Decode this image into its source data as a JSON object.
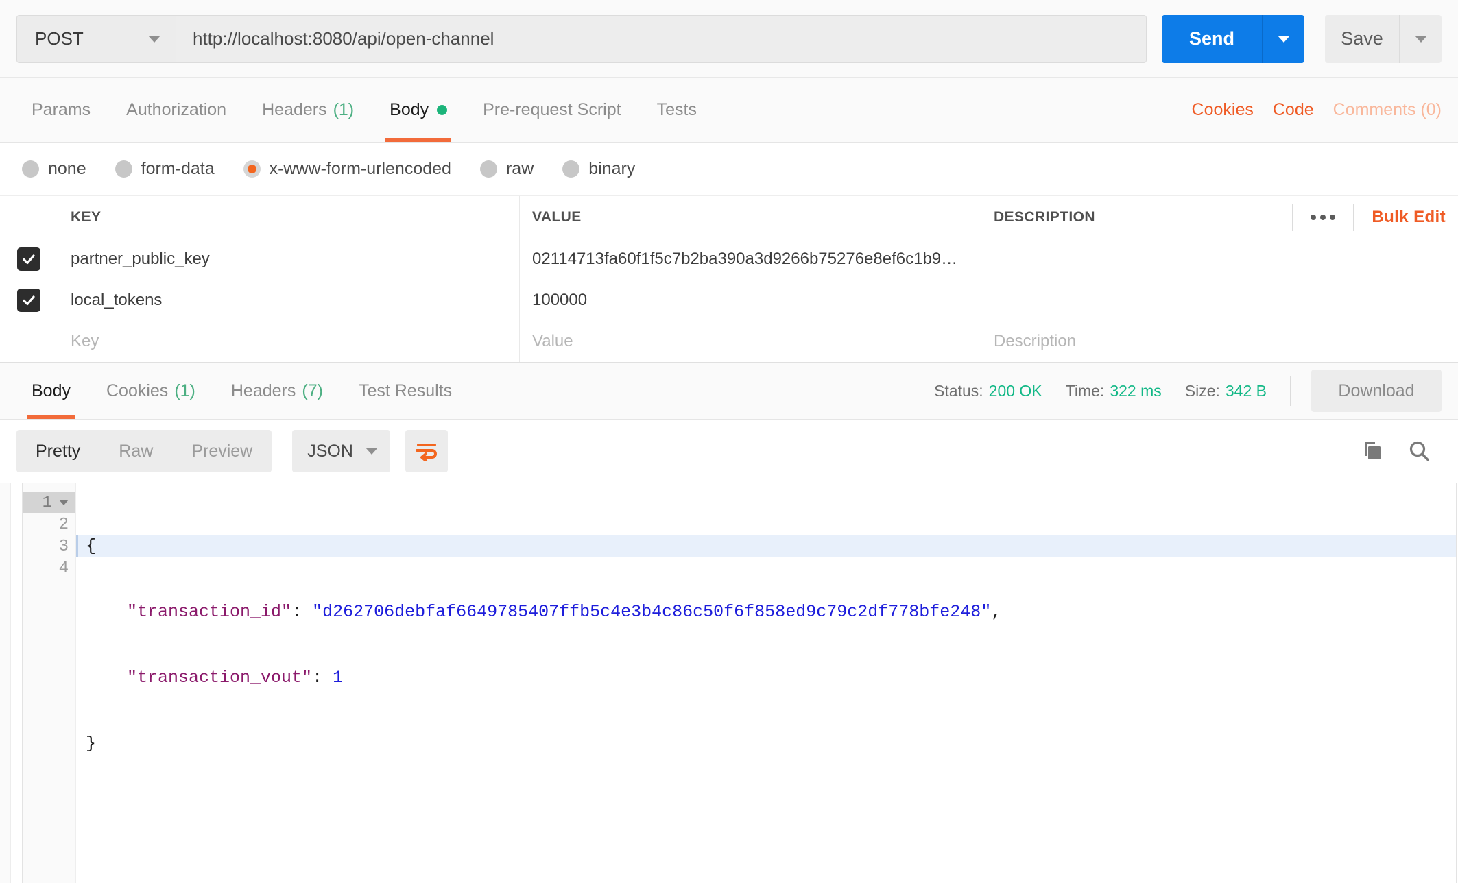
{
  "request": {
    "method": "POST",
    "url": "http://localhost:8080/api/open-channel",
    "send_label": "Send",
    "save_label": "Save"
  },
  "request_tabs": {
    "items": [
      {
        "label": "Params",
        "count": ""
      },
      {
        "label": "Authorization",
        "count": ""
      },
      {
        "label": "Headers",
        "count": "(1)"
      },
      {
        "label": "Body",
        "count": ""
      },
      {
        "label": "Pre-request Script",
        "count": ""
      },
      {
        "label": "Tests",
        "count": ""
      }
    ],
    "links": [
      {
        "label": "Cookies"
      },
      {
        "label": "Code"
      },
      {
        "label": "Comments (0)"
      }
    ]
  },
  "body_types": [
    {
      "label": "none"
    },
    {
      "label": "form-data"
    },
    {
      "label": "x-www-form-urlencoded"
    },
    {
      "label": "raw"
    },
    {
      "label": "binary"
    }
  ],
  "params_table": {
    "headers": {
      "key": "KEY",
      "value": "VALUE",
      "description": "DESCRIPTION"
    },
    "bulk_edit": "Bulk Edit",
    "rows": [
      {
        "key": "partner_public_key",
        "value": "02114713fa60f1f5c7b2ba390a3d9266b75276e8ef6c1b9…",
        "description": ""
      },
      {
        "key": "local_tokens",
        "value": "100000",
        "description": ""
      }
    ],
    "placeholders": {
      "key": "Key",
      "value": "Value",
      "description": "Description"
    }
  },
  "response_tabs": {
    "items": [
      {
        "label": "Body",
        "count": ""
      },
      {
        "label": "Cookies",
        "count": "(1)"
      },
      {
        "label": "Headers",
        "count": "(7)"
      },
      {
        "label": "Test Results",
        "count": ""
      }
    ],
    "status_label": "Status:",
    "status_value": "200 OK",
    "time_label": "Time:",
    "time_value": "322 ms",
    "size_label": "Size:",
    "size_value": "342 B",
    "download_label": "Download"
  },
  "view_toolbar": {
    "modes": [
      {
        "label": "Pretty"
      },
      {
        "label": "Raw"
      },
      {
        "label": "Preview"
      }
    ],
    "format": "JSON"
  },
  "response_body": {
    "lines": [
      "1",
      "2",
      "3",
      "4"
    ],
    "open_brace": "{",
    "close_brace": "}",
    "key1": "\"transaction_id\"",
    "val1": "\"d262706debfaf6649785407ffb5c4e3b4c86c50f6f858ed9c79c2df778bfe248\"",
    "key2": "\"transaction_vout\"",
    "val2": "1",
    "colon": ": ",
    "comma": ","
  },
  "colors": {
    "accent_orange": "#ef5b25",
    "send_blue": "#0d7ce8",
    "status_green": "#12b886",
    "json_key": "#8b1a6b",
    "json_string": "#1d1ddb"
  }
}
